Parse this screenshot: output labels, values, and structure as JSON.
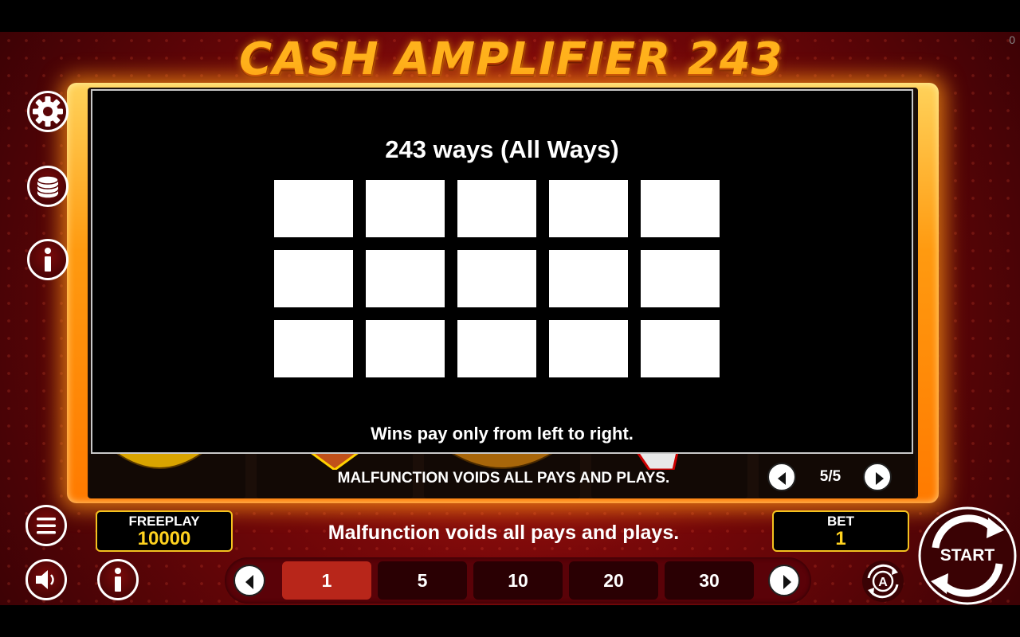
{
  "game": {
    "title": "CASH AMPLIFIER 243",
    "corner_counter": "0"
  },
  "sidebar": {
    "icons": [
      "gear-icon",
      "coins-stack-icon",
      "info-icon",
      "menu-icon",
      "speaker-icon"
    ]
  },
  "info_panel": {
    "heading": "243 ways (All Ways)",
    "grid": {
      "rows": 3,
      "cols": 5
    },
    "footer": "Wins pay only from left to right."
  },
  "pager": {
    "notice": "MALFUNCTION VOIDS ALL PAYS AND PLAYS.",
    "page_text": "5/5"
  },
  "balance": {
    "label": "FREEPLAY",
    "value": "10000"
  },
  "bet": {
    "label": "BET",
    "value": "1"
  },
  "status_message": "Malfunction voids all pays and plays.",
  "bet_options": [
    "1",
    "5",
    "10",
    "20",
    "30"
  ],
  "bet_selected_index": 0,
  "start_button": {
    "label": "START"
  },
  "auto_button": {
    "letter": "A"
  },
  "colors": {
    "accent_gold": "#f4c21f",
    "selected_bet": "#b8261a",
    "frame_orange": "#ff9a10"
  }
}
